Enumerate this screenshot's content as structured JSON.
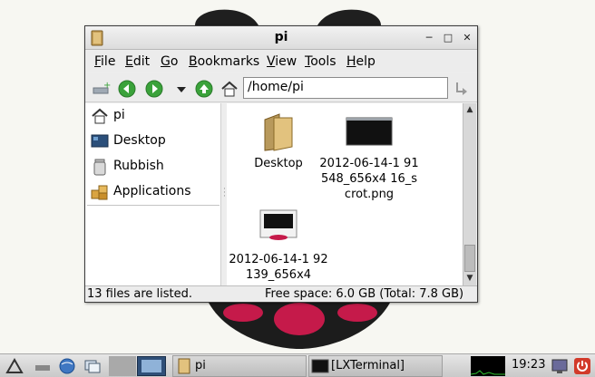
{
  "window": {
    "title": "pi",
    "menu": [
      "File",
      "Edit",
      "Go",
      "Bookmarks",
      "View",
      "Tools",
      "Help"
    ],
    "menu_mnemonics": [
      "F",
      "E",
      "G",
      "B",
      "V",
      "T",
      "H"
    ],
    "address": "/home/pi"
  },
  "sidebar": {
    "items": [
      {
        "label": "pi",
        "icon": "home-icon"
      },
      {
        "label": "Desktop",
        "icon": "desktop-icon"
      },
      {
        "label": "Rubbish",
        "icon": "trash-icon"
      },
      {
        "label": "Applications",
        "icon": "applications-icon"
      }
    ]
  },
  "files": [
    {
      "name": "Desktop",
      "icon": "folder-icon"
    },
    {
      "name": "2012-06-14-1 91548_656x4 16_scrot.png",
      "icon": "image-thumbnail-icon"
    },
    {
      "name": "2012-06-14-1 92139_656x4",
      "icon": "image-thumbnail-icon"
    }
  ],
  "status": {
    "count": "13 files are listed.",
    "free_space": "Free space: 6.0 GB (Total: 7.8 GB)"
  },
  "taskbar": {
    "tasks": [
      {
        "label": "pi",
        "icon": "folder-icon"
      },
      {
        "label": "[LXTerminal]",
        "icon": "terminal-icon"
      }
    ],
    "clock": "19:23"
  },
  "colors": {
    "raspberry": "#c51a4a",
    "leaf": "#3a3a3a",
    "arrow_green": "#3aa23a"
  }
}
